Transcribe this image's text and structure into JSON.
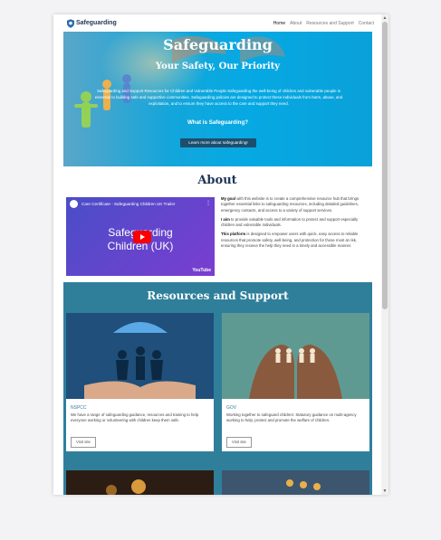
{
  "nav": {
    "brand": "Safeguarding",
    "links": [
      "Home",
      "About",
      "Resources and Support",
      "Contact"
    ]
  },
  "hero": {
    "title": "Safeguarding",
    "subtitle": "Your Safety, Our Priority",
    "description": "Safeguarding and Support Resources for Children and Vulnerable People Safeguarding the well-being of children and vulnerable people is essential to building safe and supportive communities. Safeguarding policies are designed to protect these individuals from harm, abuse, and exploitation, and to ensure they have access to the care and support they need.",
    "question": "What is Safeguarding?",
    "button": "Learn more about safeguarding!"
  },
  "about": {
    "title": "About",
    "video": {
      "title": "Care Certificate - Safeguarding Children UK Trailer",
      "big_text_line1": "Safeguarding",
      "big_text_line2": "Children (UK)",
      "brand": "YouTube"
    },
    "paragraphs": [
      {
        "lead": "My goal",
        "text": " with this website is to create a comprehensive resource hub that brings together essential links to safeguarding resources, including detailed guidelines, emergency contacts, and access to a variety of support services."
      },
      {
        "lead": "I aim",
        "text": " to provide valuable tools and information to protect and support especially children and vulnerable individuals."
      },
      {
        "lead": "This platform",
        "text": " is designed to empower users with quick, easy access to reliable resources that promote safety, well-being, and protection for those most at risk, ensuring they receive the help they need in a timely and accessible manner."
      }
    ]
  },
  "resources": {
    "title": "Resources and Support",
    "cards": [
      {
        "name": "NSPCC",
        "description": "We have a range of safeguarding guidance, resources and training to help everyone working or volunteering with children keep them safe.",
        "button": "Visit site"
      },
      {
        "name": "GOV",
        "description": "Working together to safeguard children: Statutory guidance on multi-agency working to help, protect and promote the welfare of children.",
        "button": "Visit site"
      }
    ]
  },
  "colors": {
    "brand_dark": "#1d3557",
    "hero_blue": "#06a9e4",
    "resources_teal": "#2f7f9b",
    "button_dark": "#1d4e6e"
  }
}
